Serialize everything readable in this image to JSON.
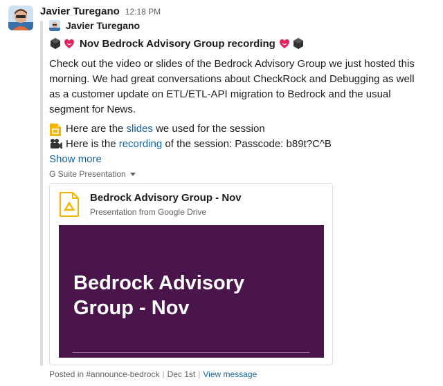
{
  "message": {
    "sender": "Javier Turegano",
    "time": "12:18 PM",
    "shared": {
      "author": "Javier Turegano",
      "title": "Nov Bedrock Advisory Group recording",
      "body": "Check out the video or slides of the Bedrock Advisory Group we just hosted this morning. We had great conversations about CheckRock and Debugging as well as a customer update on ETL/ETL-API migration to Bedrock and the usual segment for News.",
      "slides_line": {
        "prefix": "Here are the ",
        "link": "slides",
        "suffix": " we used for the session"
      },
      "recording_line": {
        "prefix": "Here is the ",
        "link": "recording",
        "suffix": " of the session: Passcode: b89t?C^B"
      },
      "show_more": "Show more"
    },
    "attachment": {
      "type_label": "G Suite Presentation",
      "title": "Bedrock Advisory Group - Nov",
      "subtitle": "Presentation from Google Drive",
      "preview_title": "Bedrock Advisory Group - Nov"
    },
    "footer": {
      "posted_in": "Posted in #announce-bedrock",
      "date": "Dec 1st",
      "view_message": "View message"
    }
  },
  "icons": {
    "emoji_1": "black-cube-icon",
    "emoji_2": "heart-face-icon",
    "slides": "google-slides-icon",
    "recording": "movie-camera-icon",
    "dropdown": "caret-down-icon"
  },
  "colors": {
    "link": "#1264a3",
    "preview_bg": "#4a154b",
    "slides_yellow": "#f4b400",
    "heart": "#e0245e"
  }
}
